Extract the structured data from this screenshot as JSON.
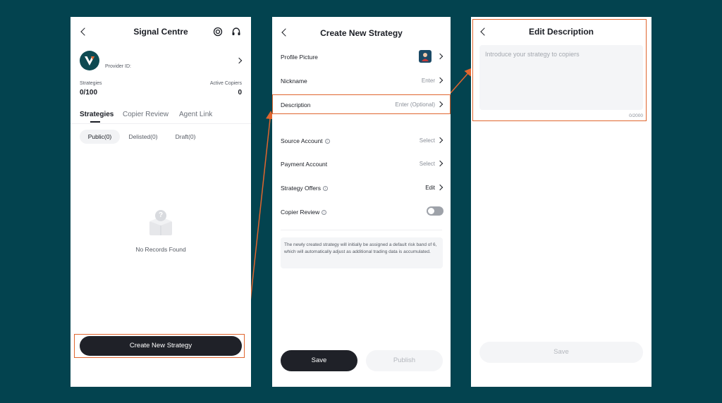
{
  "colors": {
    "background": "#03434f",
    "accent": "#e0662f",
    "dark_button": "#1f2128",
    "muted": "#8a8f98"
  },
  "signal_centre": {
    "title": "Signal Centre",
    "provider_label": "Provider ID:",
    "strategies_label": "Strategies",
    "strategies_value": "0/100",
    "copiers_label": "Active Copiers",
    "copiers_value": "0",
    "tabs": [
      "Strategies",
      "Copier Review",
      "Agent Link"
    ],
    "filters": [
      "Public(0)",
      "Delisted(0)",
      "Draft(0)"
    ],
    "empty_text": "No Records Found",
    "empty_icon_glyph": "?",
    "create_button": "Create New Strategy"
  },
  "create_strategy": {
    "title": "Create New Strategy",
    "rows": [
      {
        "label": "Profile Picture",
        "value": ""
      },
      {
        "label": "Nickname",
        "value": "Enter"
      },
      {
        "label": "Description",
        "value": "Enter (Optional)"
      },
      {
        "label": "Source Account",
        "value": "Select"
      },
      {
        "label": "Payment Account",
        "value": "Select"
      },
      {
        "label": "Strategy Offers",
        "value": "Edit"
      },
      {
        "label": "Copier Review",
        "value": ""
      }
    ],
    "info_glyph": "i",
    "copier_review_toggle": false,
    "notice": "The newly created strategy will initially be assigned a default risk band of 6, which will automatically adjust as additional trading data is accumulated.",
    "save_button": "Save",
    "publish_button": "Publish"
  },
  "edit_description": {
    "title": "Edit Description",
    "placeholder": "Introduce your strategy to copiers",
    "counter": "0/2000",
    "save_button": "Save"
  }
}
